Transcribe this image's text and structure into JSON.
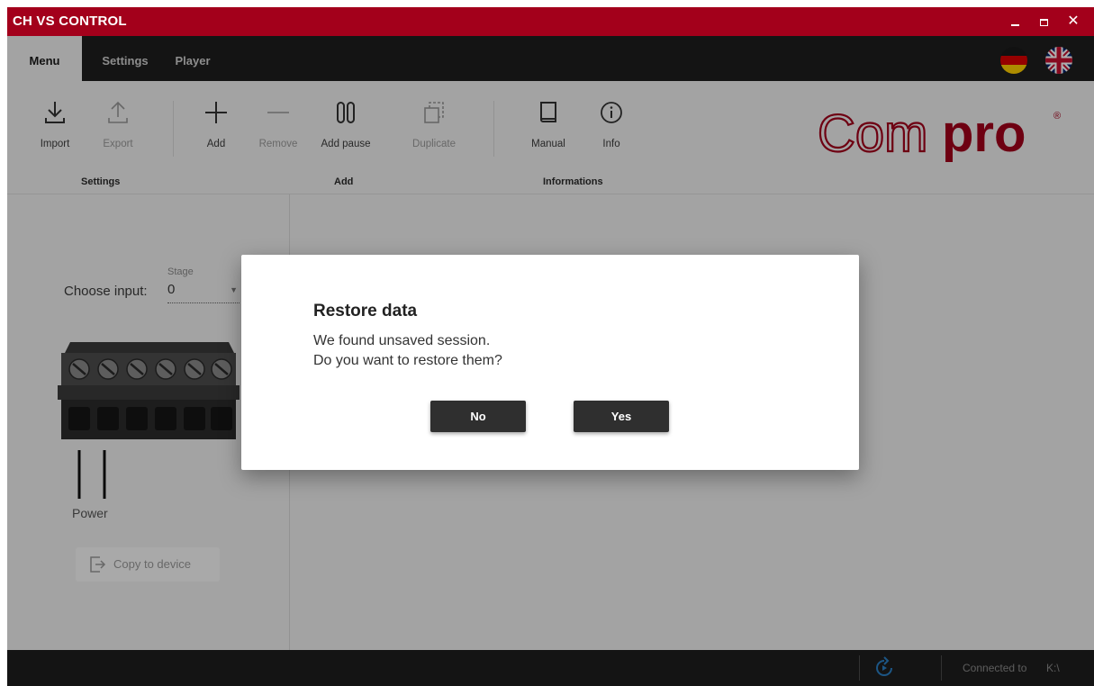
{
  "window": {
    "title": "CH VS CONTROL",
    "accent_color": "#a3001b",
    "controls": {
      "minimize_icon": "minimize-icon",
      "maximize_icon": "maximize-icon",
      "close_icon": "close-icon",
      "close_glyph": "✕"
    }
  },
  "tabs": [
    {
      "label": "Menu",
      "active": true
    },
    {
      "label": "Settings",
      "active": false
    },
    {
      "label": "Player",
      "active": false
    }
  ],
  "languages": [
    "german-flag-icon",
    "uk-flag-icon"
  ],
  "ribbon": {
    "groups": [
      {
        "label": "Settings",
        "items": [
          {
            "label": "Import",
            "icon": "import-icon",
            "enabled": true
          },
          {
            "label": "Export",
            "icon": "export-icon",
            "enabled": false
          }
        ]
      },
      {
        "label": "Add",
        "items": [
          {
            "label": "Add",
            "icon": "plus-icon",
            "enabled": true
          },
          {
            "label": "Remove",
            "icon": "minus-icon",
            "enabled": false
          },
          {
            "label": "Add pause",
            "icon": "pause-icon",
            "enabled": true
          },
          {
            "label": "Duplicate",
            "icon": "duplicate-icon",
            "enabled": false
          }
        ]
      },
      {
        "label": "Informations",
        "items": [
          {
            "label": "Manual",
            "icon": "book-icon",
            "enabled": true
          },
          {
            "label": "Info",
            "icon": "info-icon",
            "enabled": true
          }
        ]
      }
    ],
    "logo": {
      "text_outline": "Com",
      "text_bold": "pro",
      "mark": "®"
    }
  },
  "input_panel": {
    "choose_label": "Choose input:",
    "stage_label": "Stage",
    "stage_value": "0",
    "power_label": "Power",
    "copy_button": "Copy to device"
  },
  "dialog": {
    "title": "Restore data",
    "line1": "We found unsaved session.",
    "line2": "Do you want to restore them?",
    "no_label": "No",
    "yes_label": "Yes"
  },
  "status": {
    "connected_label": "Connected to",
    "connected_value": "K:\\"
  }
}
